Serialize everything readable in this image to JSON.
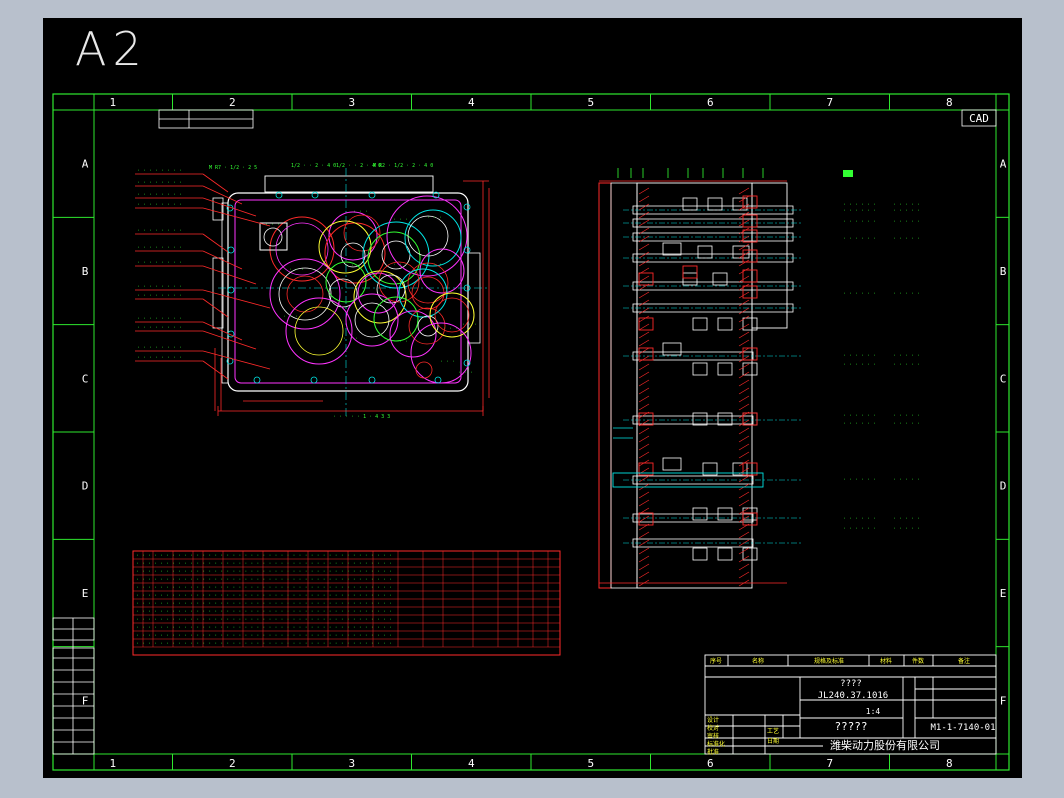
{
  "sheet": {
    "size_label": "A2",
    "cad_tag": "CAD",
    "columns": [
      "1",
      "2",
      "3",
      "4",
      "5",
      "6",
      "7",
      "8"
    ],
    "rows": [
      "A",
      "B",
      "C",
      "D",
      "E",
      "F"
    ]
  },
  "title_block": {
    "header_cells": [
      "序号",
      "名称",
      "规格及标准",
      "材料",
      "件数",
      "备注"
    ],
    "drawing_title": "????",
    "drawing_number": "JL240.37.1016",
    "scale": "1:4",
    "part_name": "?????",
    "code": "M1-1-7140-01",
    "company": "潍柴动力股份有限公司",
    "roles": [
      "设计",
      "校对",
      "审核",
      "标准化",
      "批准"
    ],
    "role_right": [
      "工艺",
      "日期"
    ]
  },
  "colors": {
    "background": "#000000",
    "frame": "#2ee82e",
    "border": "#ffffff",
    "red": "#ff2a2a",
    "green": "#33ff33",
    "cyan": "#00e5e5",
    "magenta": "#ff33ff",
    "yellow": "#ffff33"
  }
}
